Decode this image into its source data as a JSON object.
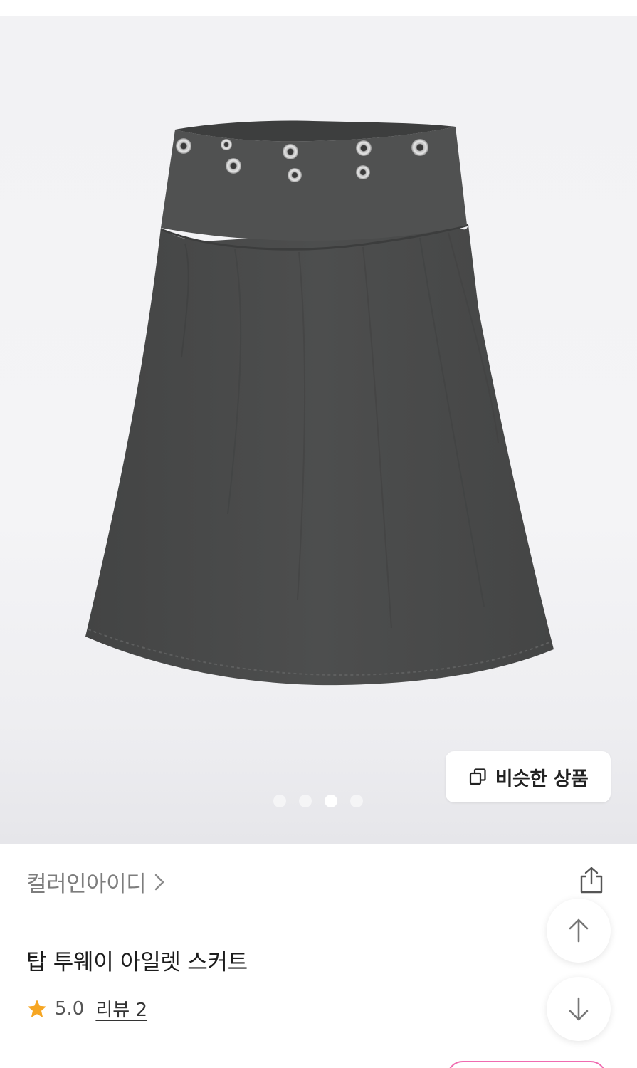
{
  "gallery": {
    "image_alt": "탑 투웨이 아일렛 스커트",
    "dots_count": 4,
    "active_dot_index": 2,
    "similar_button_label": "비슷한 상품",
    "similar_button_icon": "copy-icon"
  },
  "brand": {
    "name": "컬러인아이디",
    "chevron_icon": "chevron-right-icon",
    "share_icon": "share-icon"
  },
  "product": {
    "title": "탑 투웨이 아일렛 스커트",
    "rating": "5.0",
    "review_label": "리뷰 2",
    "star_icon": "star-icon"
  },
  "floating": {
    "scroll_up_icon": "arrow-up-icon",
    "scroll_down_icon": "arrow-down-icon"
  },
  "colors": {
    "skirt": "#4a4b4b",
    "star": "#f6a623",
    "accent": "#f06bb0",
    "brand_text": "#7d7d7d"
  }
}
